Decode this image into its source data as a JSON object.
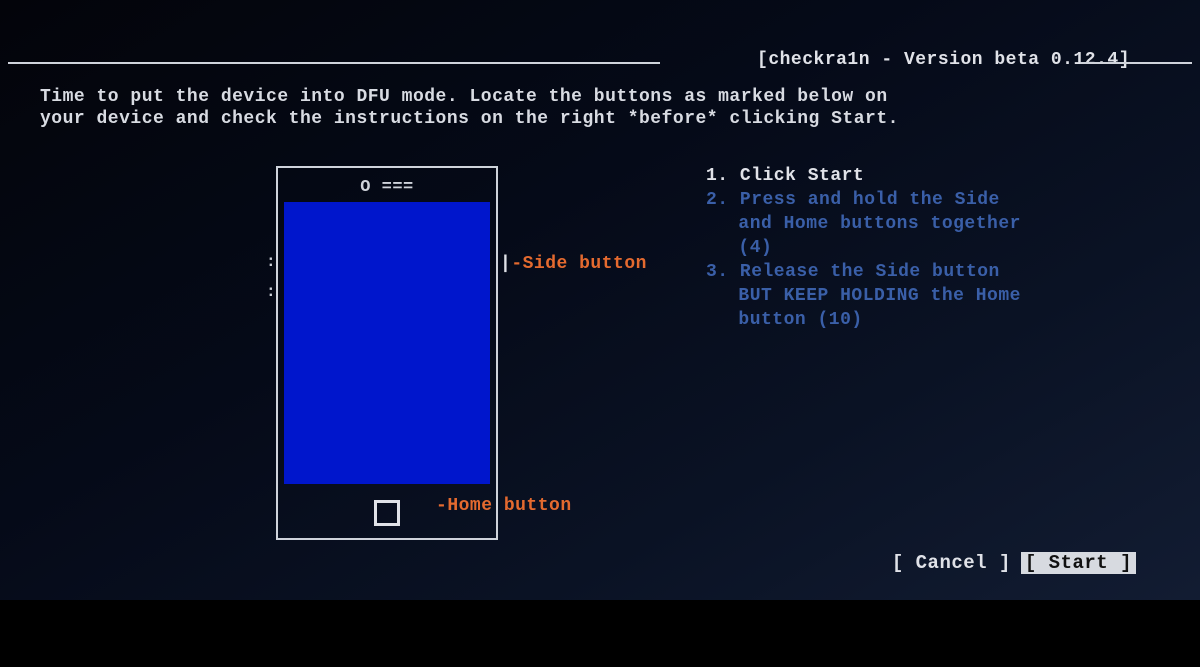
{
  "title": {
    "open": "[",
    "name": "checkra1n",
    "sep": " - ",
    "version_label": "Version beta",
    "version": "0.12.4",
    "close": "]"
  },
  "intro": {
    "line1": "Time to put the device into DFU mode. Locate the buttons as marked below on",
    "line2": "your device and check the instructions on the right *before* clicking Start."
  },
  "phone": {
    "earpiece": "O ===",
    "vol_mark": ":",
    "side_label": "Side button",
    "home_label": "Home button"
  },
  "steps": [
    {
      "n": "1.",
      "a": true,
      "lines": [
        "Click Start"
      ]
    },
    {
      "n": "2.",
      "a": false,
      "lines": [
        "Press and hold the Side",
        "and Home buttons together",
        "(4)"
      ]
    },
    {
      "n": "3.",
      "a": false,
      "lines": [
        "Release the Side button",
        "BUT KEEP HOLDING the Home",
        "button (10)"
      ]
    }
  ],
  "buttons": {
    "cancel": "[ Cancel ]",
    "start": "[  Start  ]"
  }
}
